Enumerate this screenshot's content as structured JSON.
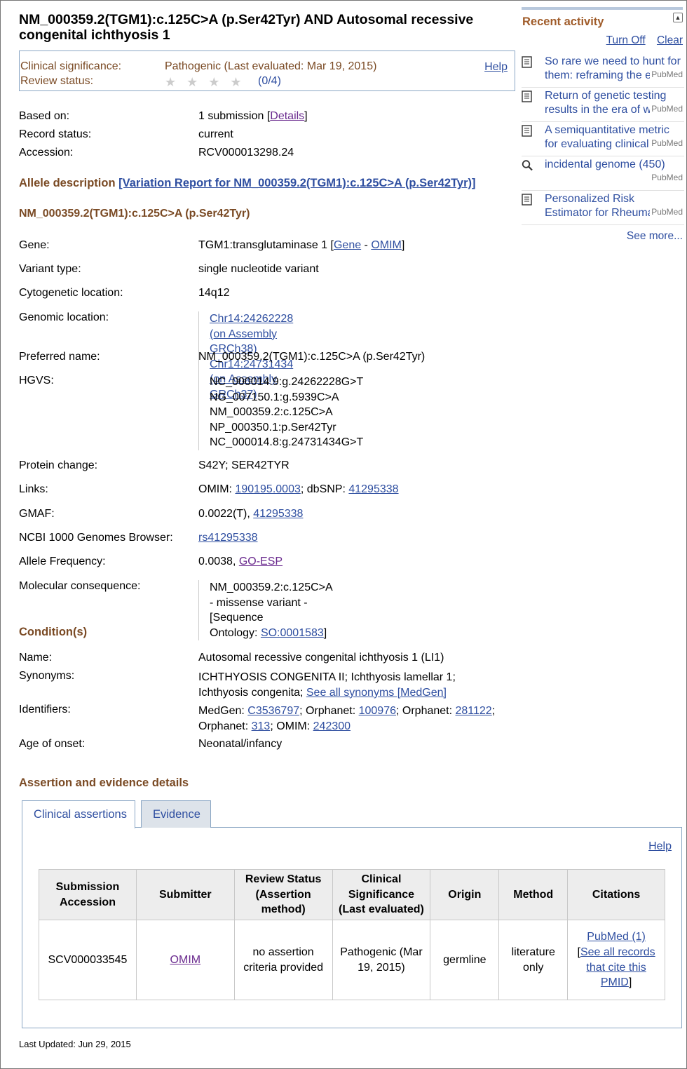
{
  "title": "NM_000359.2(TGM1):c.125C>A (p.Ser42Tyr) AND Autosomal recessive congenital ichthyosis 1",
  "significance": {
    "label": "Clinical significance:",
    "value": "Pathogenic (Last evaluated: Mar 19, 2015)",
    "review_label": "Review status:",
    "stars": "★★★★",
    "stars_count": "(0/4)",
    "help": "Help"
  },
  "record": {
    "based_on_label": "Based on:",
    "based_on_text": "1 submission [",
    "based_on_link": "Details",
    "based_on_end": "]",
    "status_label": "Record status:",
    "status": "current",
    "accession_label": "Accession:",
    "accession": "RCV000013298.24"
  },
  "allele": {
    "heading": "Allele description",
    "report_link": "[Variation Report for NM_000359.2(TGM1):c.125C>A (p.Ser42Tyr)]",
    "name_heading": "NM_000359.2(TGM1):c.125C>A (p.Ser42Tyr)",
    "gene_label": "Gene:",
    "gene_text": "TGM1:transglutaminase 1 [",
    "gene_link": "Gene",
    "gene_sep": " - ",
    "gene_omim": "OMIM",
    "gene_end": "]",
    "variant_type_label": "Variant type:",
    "variant_type": "single nucleotide variant",
    "cyto_label": "Cytogenetic location:",
    "cyto": "14q12",
    "genomic_label": "Genomic location:",
    "genomic": [
      "Chr14:24262228 (on Assembly GRCh38)",
      "Chr14:24731434 (on Assembly GRCh37)"
    ],
    "preferred_label": "Preferred name:",
    "preferred": "NM_000359.2(TGM1):c.125C>A (p.Ser42Tyr)",
    "hgvs_label": "HGVS:",
    "hgvs": [
      "NC_000014.9:g.24262228G>T",
      "NG_007150.1:g.5939C>A",
      "NM_000359.2:c.125C>A",
      "NP_000350.1:p.Ser42Tyr",
      "NC_000014.8:g.24731434G>T"
    ],
    "protein_label": "Protein change:",
    "protein": "S42Y; SER42TYR",
    "links_label": "Links:",
    "links_omim_text": "OMIM: ",
    "links_omim": "190195.0003",
    "links_dbsnp_text": "; dbSNP: ",
    "links_dbsnp": "41295338",
    "gmaf_label": "GMAF:",
    "gmaf_text": "0.0022(T), ",
    "gmaf_link": "41295338",
    "browser_label": "NCBI 1000 Genomes Browser:",
    "browser_link": "rs41295338",
    "freq_label": "Allele Frequency:",
    "freq_text": "0.0038, ",
    "freq_link": "GO-ESP",
    "molcon_label": "Molecular consequence:",
    "molcon_text1": "NM_000359.2:c.125C>A - missense variant - [Sequence",
    "molcon_text2": "Ontology: ",
    "molcon_link": "SO:0001583",
    "molcon_end": "]"
  },
  "condition": {
    "heading": "Condition(s)",
    "name_label": "Name:",
    "name": "Autosomal recessive congenital ichthyosis 1 (LI1)",
    "syn_label": "Synonyms:",
    "syn_line1": "ICHTHYOSIS CONGENITA II; Ichthyosis lamellar 1;",
    "syn_line2": "Ichthyosis congenita; ",
    "syn_link": "See all synonyms [MedGen]",
    "id_label": "Identifiers:",
    "id_medgen_text": "MedGen: ",
    "id_medgen": "C3536797",
    "id_orph1_text": "; Orphanet: ",
    "id_orph1": "100976",
    "id_orph2_text": "; Orphanet: ",
    "id_orph2": "281122",
    "id_orph2_end": ";",
    "id_orph3_text": "Orphanet: ",
    "id_orph3": "313",
    "id_omim_text": "; OMIM: ",
    "id_omim": "242300",
    "onset_label": "Age of onset:",
    "onset": "Neonatal/infancy"
  },
  "assertion": {
    "heading": "Assertion and evidence details",
    "tabs": [
      "Clinical assertions",
      "Evidence"
    ],
    "help": "Help",
    "columns": [
      "Submission Accession",
      "Submitter",
      "Review Status (Assertion method)",
      "Clinical Significance (Last evaluated)",
      "Origin",
      "Method",
      "Citations"
    ],
    "row": {
      "accession": "SCV000033545",
      "submitter": "OMIM",
      "review": "no assertion criteria provided",
      "significance": "Pathogenic (Mar 19, 2015)",
      "origin": "germline",
      "method": "literature only",
      "cite_pubmed": "PubMed (1)",
      "cite_open": "[",
      "cite_link": "See all records that cite this PMID",
      "cite_close": "]"
    }
  },
  "recent_activity": {
    "title": "Recent activity",
    "turn_off": "Turn Off",
    "clear": "Clear",
    "items": [
      {
        "icon": "document-icon",
        "text": "So rare we need to hunt for them: reframing the ethical debate",
        "source": "PubMed"
      },
      {
        "icon": "document-icon",
        "text": "Return of genetic testing results in the era of whole-genome",
        "source": "PubMed"
      },
      {
        "icon": "document-icon",
        "text": "A semiquantitative metric for evaluating clinical actionability",
        "source": "PubMed"
      },
      {
        "icon": "search-icon",
        "text": "incidental genome (450)",
        "source": "PubMed"
      },
      {
        "icon": "document-icon",
        "text": "Personalized Risk Estimator for Rheumatoid Arthritis",
        "source": "PubMed"
      }
    ],
    "see_more": "See more..."
  },
  "last_updated": "Last Updated: Jun 29, 2015"
}
